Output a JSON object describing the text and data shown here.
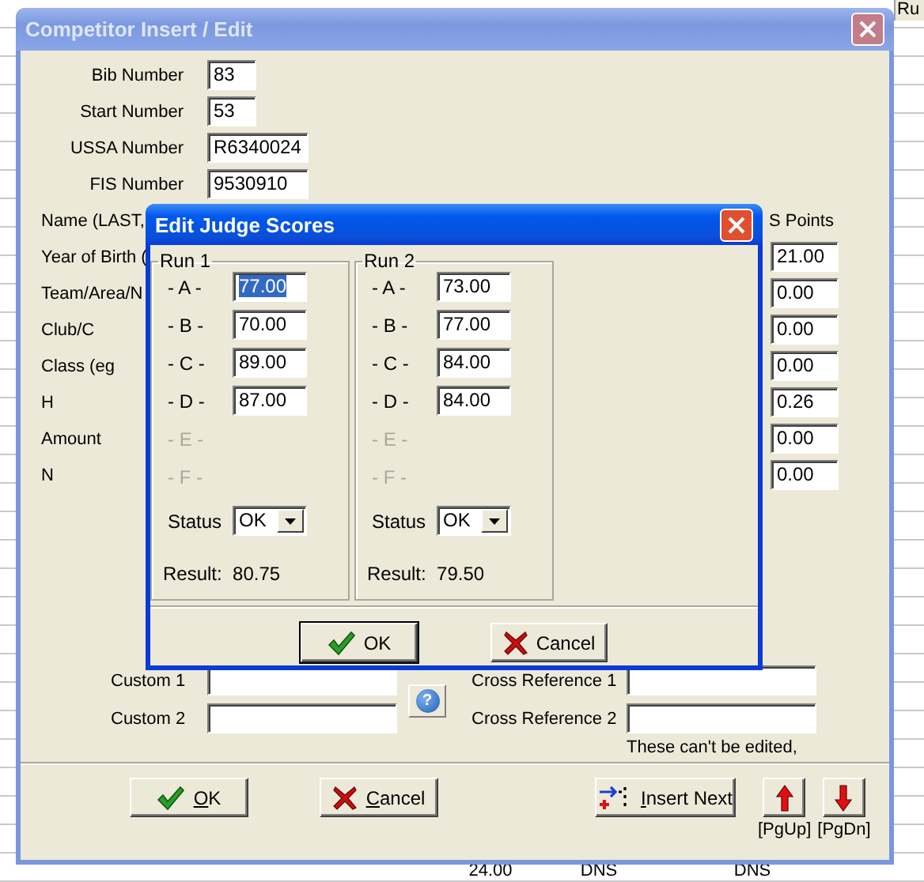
{
  "background": {
    "header_cell": "Ru",
    "bottom_row": [
      "24.00",
      "DNS",
      "DNS"
    ]
  },
  "window": {
    "title": "Competitor Insert / Edit"
  },
  "fields": [
    {
      "label": "Bib Number",
      "value": "83",
      "kind": "short"
    },
    {
      "label": "Start Number",
      "value": "53",
      "kind": "short"
    },
    {
      "label": "USSA Number",
      "value": "R6340024",
      "kind": "medium"
    },
    {
      "label": "FIS Number",
      "value": "9530910",
      "kind": "medium"
    },
    {
      "label": "Name (LAST,",
      "kind": "covered",
      "points_heading": "S Points"
    },
    {
      "label": "Year of Birth (",
      "kind": "covered",
      "points": "21.00"
    },
    {
      "label": "Team/Area/N",
      "kind": "covered",
      "points": "0.00"
    },
    {
      "label": "Club/C",
      "kind": "covered",
      "points": "0.00"
    },
    {
      "label": "Class (eg",
      "kind": "covered",
      "points": "0.00"
    },
    {
      "label": "H",
      "kind": "covered",
      "points": "0.26"
    },
    {
      "label": "Amount",
      "kind": "covered",
      "points": "0.00"
    },
    {
      "label": "N",
      "kind": "covered",
      "points": "0.00"
    }
  ],
  "dialog": {
    "title": "Edit Judge Scores",
    "runs": [
      {
        "title": "Run 1",
        "status_label": "Status",
        "status": "OK",
        "result_label": "Result:",
        "result": "80.75",
        "judges": [
          {
            "label": "- A -",
            "value": "77.00",
            "selected": true,
            "disabled": false
          },
          {
            "label": "- B -",
            "value": "70.00",
            "selected": false,
            "disabled": false
          },
          {
            "label": "- C -",
            "value": "89.00",
            "selected": false,
            "disabled": false
          },
          {
            "label": "- D -",
            "value": "87.00",
            "selected": false,
            "disabled": false
          },
          {
            "label": "- E -",
            "disabled": true
          },
          {
            "label": "- F -",
            "disabled": true
          }
        ]
      },
      {
        "title": "Run 2",
        "status_label": "Status",
        "status": "OK",
        "result_label": "Result:",
        "result": "79.50",
        "judges": [
          {
            "label": "- A -",
            "value": "73.00",
            "selected": false,
            "disabled": false
          },
          {
            "label": "- B -",
            "value": "77.00",
            "selected": false,
            "disabled": false
          },
          {
            "label": "- C -",
            "value": "84.00",
            "selected": false,
            "disabled": false
          },
          {
            "label": "- D -",
            "value": "84.00",
            "selected": false,
            "disabled": false
          },
          {
            "label": "- E -",
            "disabled": true
          },
          {
            "label": "- F -",
            "disabled": true
          }
        ]
      }
    ],
    "buttons": [
      {
        "label": "OK",
        "kind": "ok",
        "default": true
      },
      {
        "label": "Cancel",
        "kind": "cancel",
        "default": false
      }
    ]
  },
  "custom": [
    {
      "label": "Custom 1"
    },
    {
      "label": "Custom 2"
    }
  ],
  "help": {
    "glyph": "?"
  },
  "cross_refs": [
    {
      "label": "Cross Reference 1"
    },
    {
      "label": "Cross Reference 2"
    }
  ],
  "note": "These can't be edited,",
  "buttons": [
    {
      "label": "OK",
      "kind": "ok",
      "access_key": true
    },
    {
      "label": "Cancel",
      "kind": "cancel",
      "access_key": true
    },
    {
      "label": "Insert Next",
      "kind": "insert",
      "access_key": true
    },
    {
      "label": "[PgUp]",
      "kind": "up"
    },
    {
      "label": "[PgDn]",
      "kind": "down"
    }
  ]
}
